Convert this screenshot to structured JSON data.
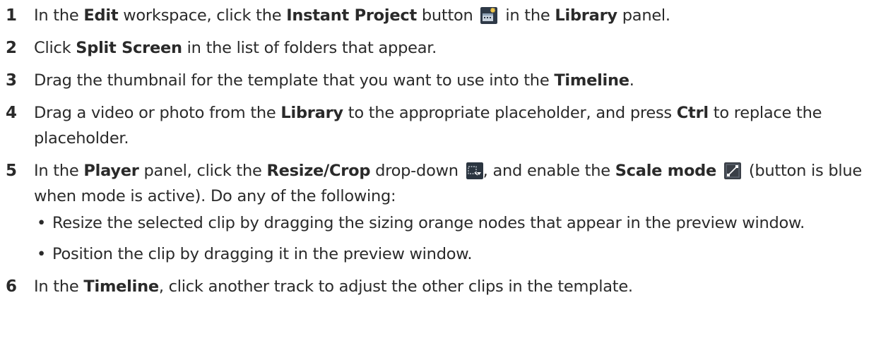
{
  "steps": [
    {
      "num": "1",
      "parts": [
        "In the ",
        "Edit",
        " workspace, click the ",
        "Instant Project",
        " button ",
        " in the ",
        "Library",
        " panel."
      ],
      "icon": "instant-project-icon"
    },
    {
      "num": "2",
      "parts": [
        "Click ",
        "Split Screen",
        " in the list of folders that appear."
      ]
    },
    {
      "num": "3",
      "parts": [
        "Drag the thumbnail for the template that you want to use into the ",
        "Timeline",
        "."
      ]
    },
    {
      "num": "4",
      "parts": [
        "Drag a video or photo from the ",
        "Library",
        " to the appropriate placeholder, and press ",
        "Ctrl",
        " to replace the placeholder."
      ]
    },
    {
      "num": "5",
      "parts": [
        "In the ",
        "Player",
        " panel, click the ",
        "Resize/Crop",
        " drop-down ",
        ", and enable the ",
        "Scale mode",
        " ",
        " (button is blue when mode is active). Do any of the following:"
      ],
      "icons": [
        "resize-crop-dropdown-icon",
        "scale-mode-icon"
      ],
      "bullets": [
        "Resize the selected clip by dragging the sizing orange nodes that appear in the preview window.",
        "Position the clip by dragging it in the preview window."
      ]
    },
    {
      "num": "6",
      "parts": [
        "In the ",
        "Timeline",
        ", click another track to adjust the other clips in the template."
      ]
    }
  ],
  "colors": {
    "text": "#2a2a2a",
    "icon_bg": "#2b3a4a",
    "scale_icon_bg": "#3a3f47"
  }
}
